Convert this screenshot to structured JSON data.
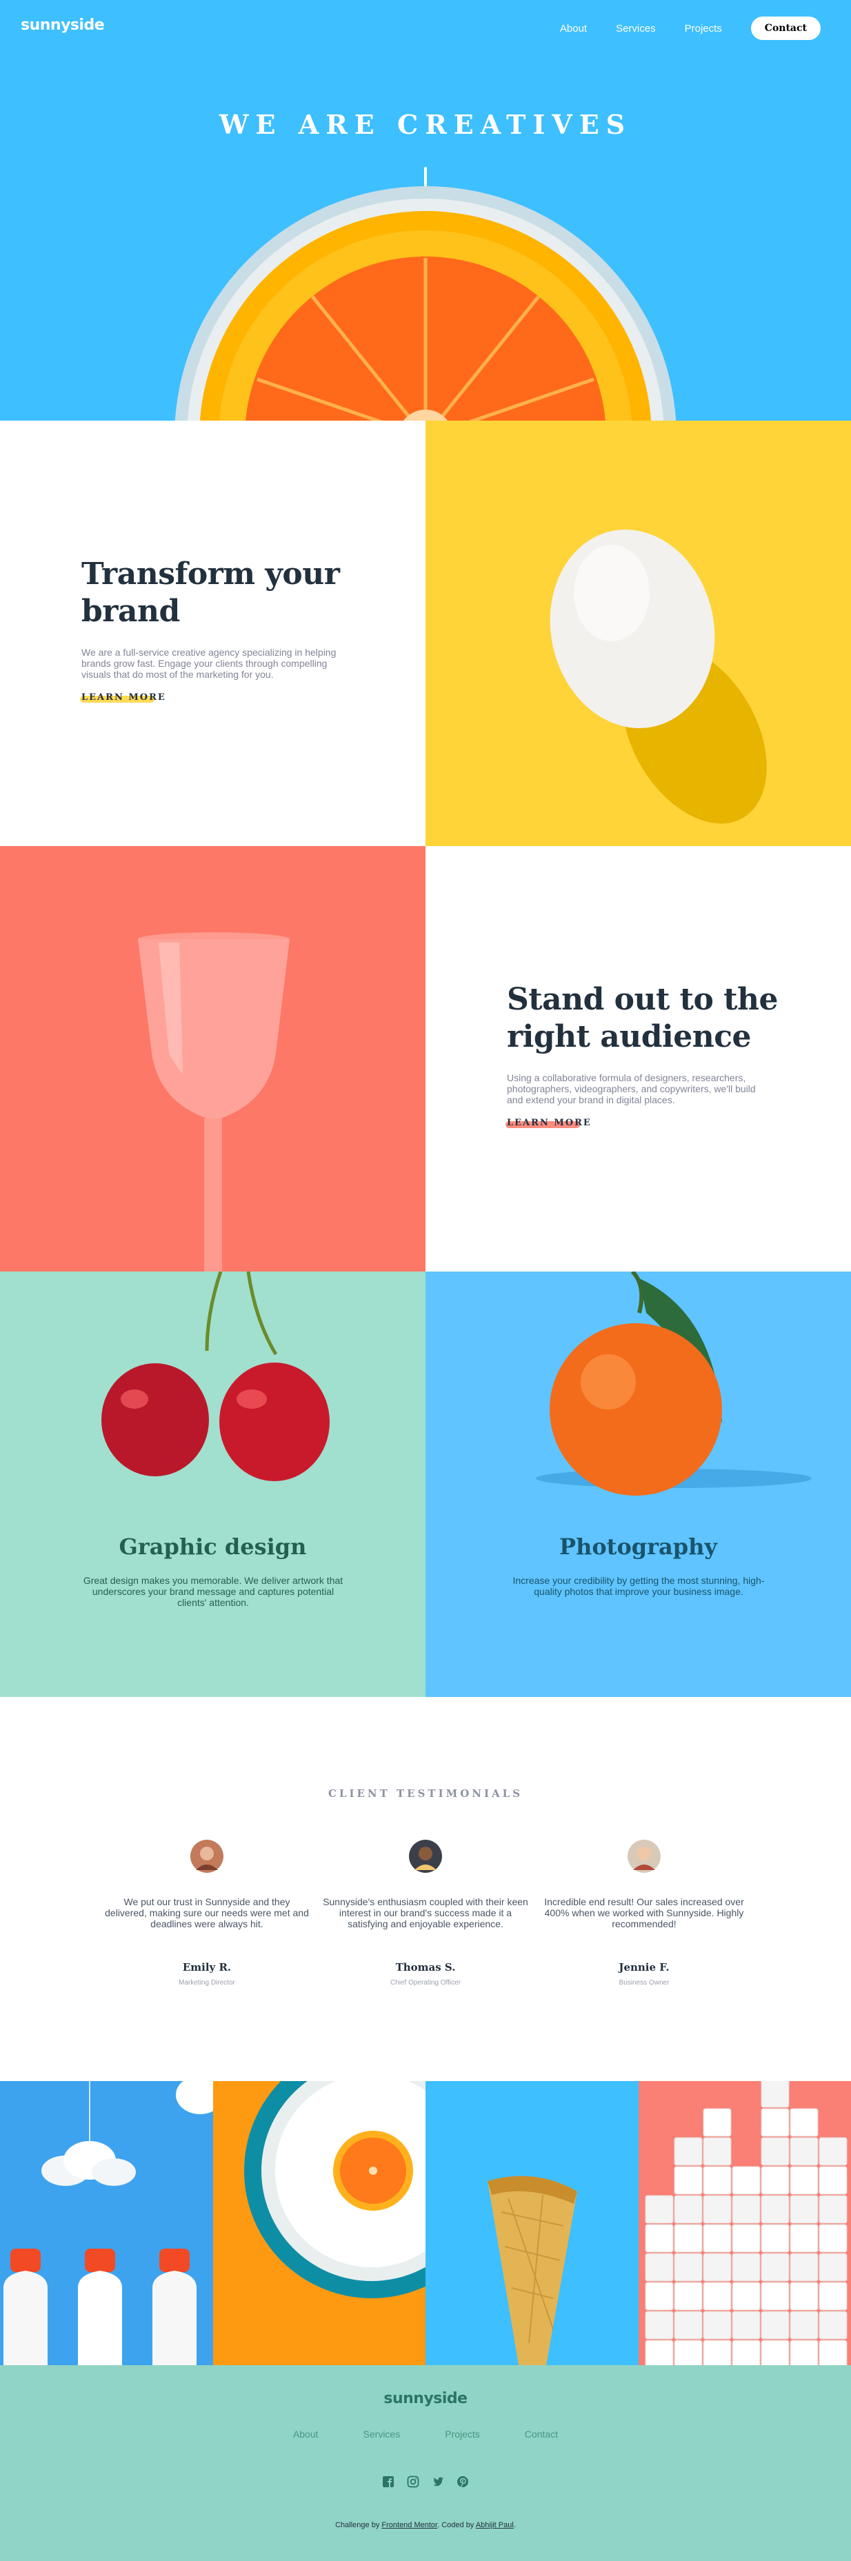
{
  "brand": {
    "logo": "sunnyside"
  },
  "nav": {
    "about": "About",
    "services": "Services",
    "projects": "Projects",
    "contact": "Contact"
  },
  "hero": {
    "title": "WE ARE CREATIVES"
  },
  "transform": {
    "title_line1": "Transform your",
    "title_line2": "brand",
    "body": "We are a full-service creative agency specializing in helping brands grow fast. Engage your clients through compelling visuals that do most of the marketing for you.",
    "cta": "LEARN MORE"
  },
  "standout": {
    "title_line1": "Stand out to the",
    "title_line2": "right audience",
    "body": "Using a collaborative formula of designers, researchers, photographers, videographers, and copywriters, we'll build and extend your brand in digital places.",
    "cta": "LEARN MORE"
  },
  "services": [
    {
      "title": "Graphic design",
      "body": "Great design makes you memorable. We deliver artwork that underscores your brand message and captures potential clients' attention."
    },
    {
      "title": "Photography",
      "body": "Increase your credibility by getting the most stunning, high-quality photos that improve your business image."
    }
  ],
  "testimonials": {
    "heading": "CLIENT TESTIMONIALS",
    "items": [
      {
        "quote": "We put our trust in Sunnyside and they delivered, making sure our needs were met and deadlines were always hit.",
        "name": "Emily R.",
        "role": "Marketing Director"
      },
      {
        "quote": "Sunnyside's enthusiasm coupled with their keen interest in our brand's success made it a satisfying and enjoyable experience.",
        "name": "Thomas S.",
        "role": "Chief Operating Officer"
      },
      {
        "quote": "Incredible end result! Our sales increased over 400% when we worked with Sunnyside. Highly recommended!",
        "name": "Jennie F.",
        "role": "Business Owner"
      }
    ]
  },
  "footer": {
    "logo": "sunnyside",
    "links": [
      "About",
      "Services",
      "Projects",
      "Contact"
    ],
    "social_icons": [
      "facebook-icon",
      "instagram-icon",
      "twitter-icon",
      "pinterest-icon"
    ],
    "credit_prefix": "Challenge by",
    "credit_fm": "Frontend Mentor",
    "credit_mid": ". Coded by",
    "credit_author": "Abhijit Paul",
    "credit_suffix": "."
  },
  "colors": {
    "hero_bg": "#3ebfff",
    "yellow": "#fed439",
    "coral": "#fe7867",
    "mint": "#a1dfcf",
    "graphic_text": "#24604f",
    "photo_text": "#19536b",
    "footer_bg": "#90d4c5"
  }
}
